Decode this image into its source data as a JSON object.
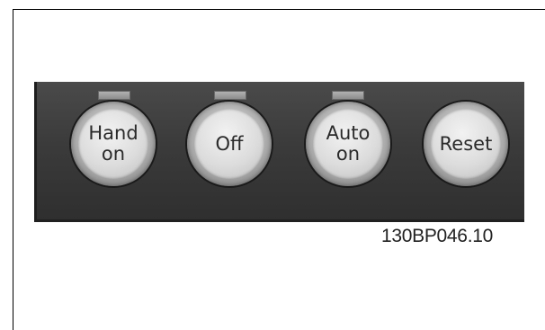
{
  "panel": {
    "buttons": [
      {
        "line1": "Hand",
        "line2": "on",
        "has_indicator": true
      },
      {
        "line1": "Off",
        "line2": "",
        "has_indicator": true
      },
      {
        "line1": "Auto",
        "line2": "on",
        "has_indicator": true
      },
      {
        "line1": "Reset",
        "line2": "",
        "has_indicator": false
      }
    ]
  },
  "figure": {
    "part_code": "130BP046.10"
  }
}
